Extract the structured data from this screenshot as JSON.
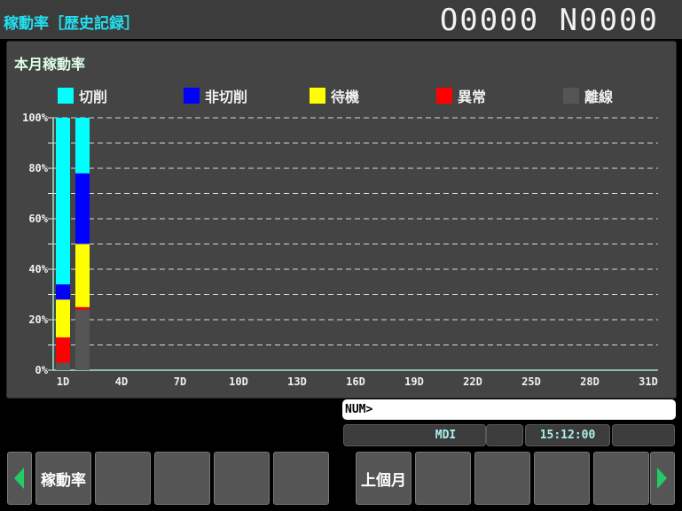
{
  "header": {
    "title": "稼動率［歴史記録］",
    "counter": "O0000 N0000"
  },
  "panel": {
    "title": "本月稼動率"
  },
  "legend": [
    {
      "label": "切削",
      "color": "#00ffff"
    },
    {
      "label": "非切削",
      "color": "#0000ff"
    },
    {
      "label": "待機",
      "color": "#ffff00"
    },
    {
      "label": "異常",
      "color": "#ff0000"
    },
    {
      "label": "離線",
      "color": "#555555"
    }
  ],
  "chart_data": {
    "type": "bar",
    "stacked": true,
    "ylim": [
      0,
      100
    ],
    "yticks": [
      "0%",
      "20%",
      "40%",
      "60%",
      "80%",
      "100%"
    ],
    "xticks": [
      "1D",
      "4D",
      "7D",
      "10D",
      "13D",
      "16D",
      "19D",
      "22D",
      "25D",
      "28D",
      "31D"
    ],
    "grid": true,
    "categories": [
      "1D",
      "2D"
    ],
    "series": [
      {
        "name": "離線",
        "color": "#555555",
        "values": [
          3,
          24
        ]
      },
      {
        "name": "異常",
        "color": "#ff0000",
        "values": [
          10,
          1
        ]
      },
      {
        "name": "待機",
        "color": "#ffff00",
        "values": [
          15,
          25
        ]
      },
      {
        "name": "非切削",
        "color": "#0000ff",
        "values": [
          6,
          28
        ]
      },
      {
        "name": "切削",
        "color": "#00ffff",
        "values": [
          66,
          22
        ]
      }
    ]
  },
  "command": {
    "prompt": "NUM>"
  },
  "status": {
    "mode": "MDI",
    "time": "15:12:00"
  },
  "softkeys": {
    "left": [
      "稼動率",
      "",
      "",
      "",
      ""
    ],
    "right": [
      "上個月",
      "",
      "",
      "",
      ""
    ]
  },
  "arrow_color": "#22cc66"
}
